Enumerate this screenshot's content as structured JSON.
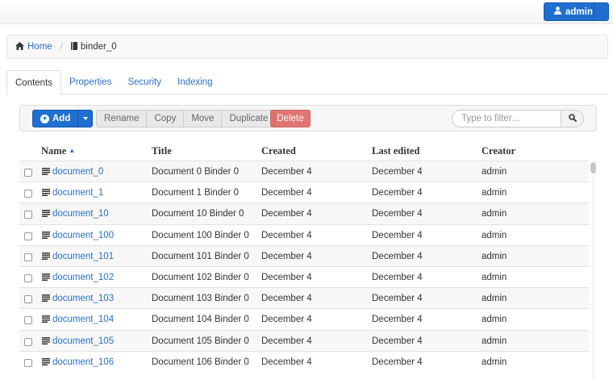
{
  "user": {
    "name": "admin",
    "icon": "user-icon"
  },
  "breadcrumb": {
    "home": {
      "label": "Home",
      "icon": "home-icon"
    },
    "current": {
      "label": "binder_0",
      "icon": "binder-icon"
    }
  },
  "tabs": [
    {
      "label": "Contents",
      "active": true
    },
    {
      "label": "Properties",
      "active": false
    },
    {
      "label": "Security",
      "active": false
    },
    {
      "label": "Indexing",
      "active": false
    }
  ],
  "toolbar": {
    "add_label": "Add",
    "rename_label": "Rename",
    "copy_label": "Copy",
    "move_label": "Move",
    "duplicate_label": "Duplicate",
    "delete_label": "Delete",
    "filter_placeholder": "Type to filter…",
    "search_icon": "search-icon"
  },
  "table": {
    "columns": {
      "name": "Name",
      "title": "Title",
      "created": "Created",
      "last_edited": "Last edited",
      "creator": "Creator"
    },
    "sort": {
      "column": "name",
      "direction": "ascending"
    },
    "rows": [
      {
        "name": "document_0",
        "title": "Document 0 Binder 0",
        "created": "December 4",
        "last_edited": "December 4",
        "creator": "admin"
      },
      {
        "name": "document_1",
        "title": "Document 1 Binder 0",
        "created": "December 4",
        "last_edited": "December 4",
        "creator": "admin"
      },
      {
        "name": "document_10",
        "title": "Document 10 Binder 0",
        "created": "December 4",
        "last_edited": "December 4",
        "creator": "admin"
      },
      {
        "name": "document_100",
        "title": "Document 100 Binder 0",
        "created": "December 4",
        "last_edited": "December 4",
        "creator": "admin"
      },
      {
        "name": "document_101",
        "title": "Document 101 Binder 0",
        "created": "December 4",
        "last_edited": "December 4",
        "creator": "admin"
      },
      {
        "name": "document_102",
        "title": "Document 102 Binder 0",
        "created": "December 4",
        "last_edited": "December 4",
        "creator": "admin"
      },
      {
        "name": "document_103",
        "title": "Document 103 Binder 0",
        "created": "December 4",
        "last_edited": "December 4",
        "creator": "admin"
      },
      {
        "name": "document_104",
        "title": "Document 104 Binder 0",
        "created": "December 4",
        "last_edited": "December 4",
        "creator": "admin"
      },
      {
        "name": "document_105",
        "title": "Document 105 Binder 0",
        "created": "December 4",
        "last_edited": "December 4",
        "creator": "admin"
      },
      {
        "name": "document_106",
        "title": "Document 106 Binder 0",
        "created": "December 4",
        "last_edited": "December 4",
        "creator": "admin"
      }
    ]
  },
  "colors": {
    "accent": "#1f6fd0",
    "link": "#2a6fc9",
    "danger": "#d9534f"
  }
}
